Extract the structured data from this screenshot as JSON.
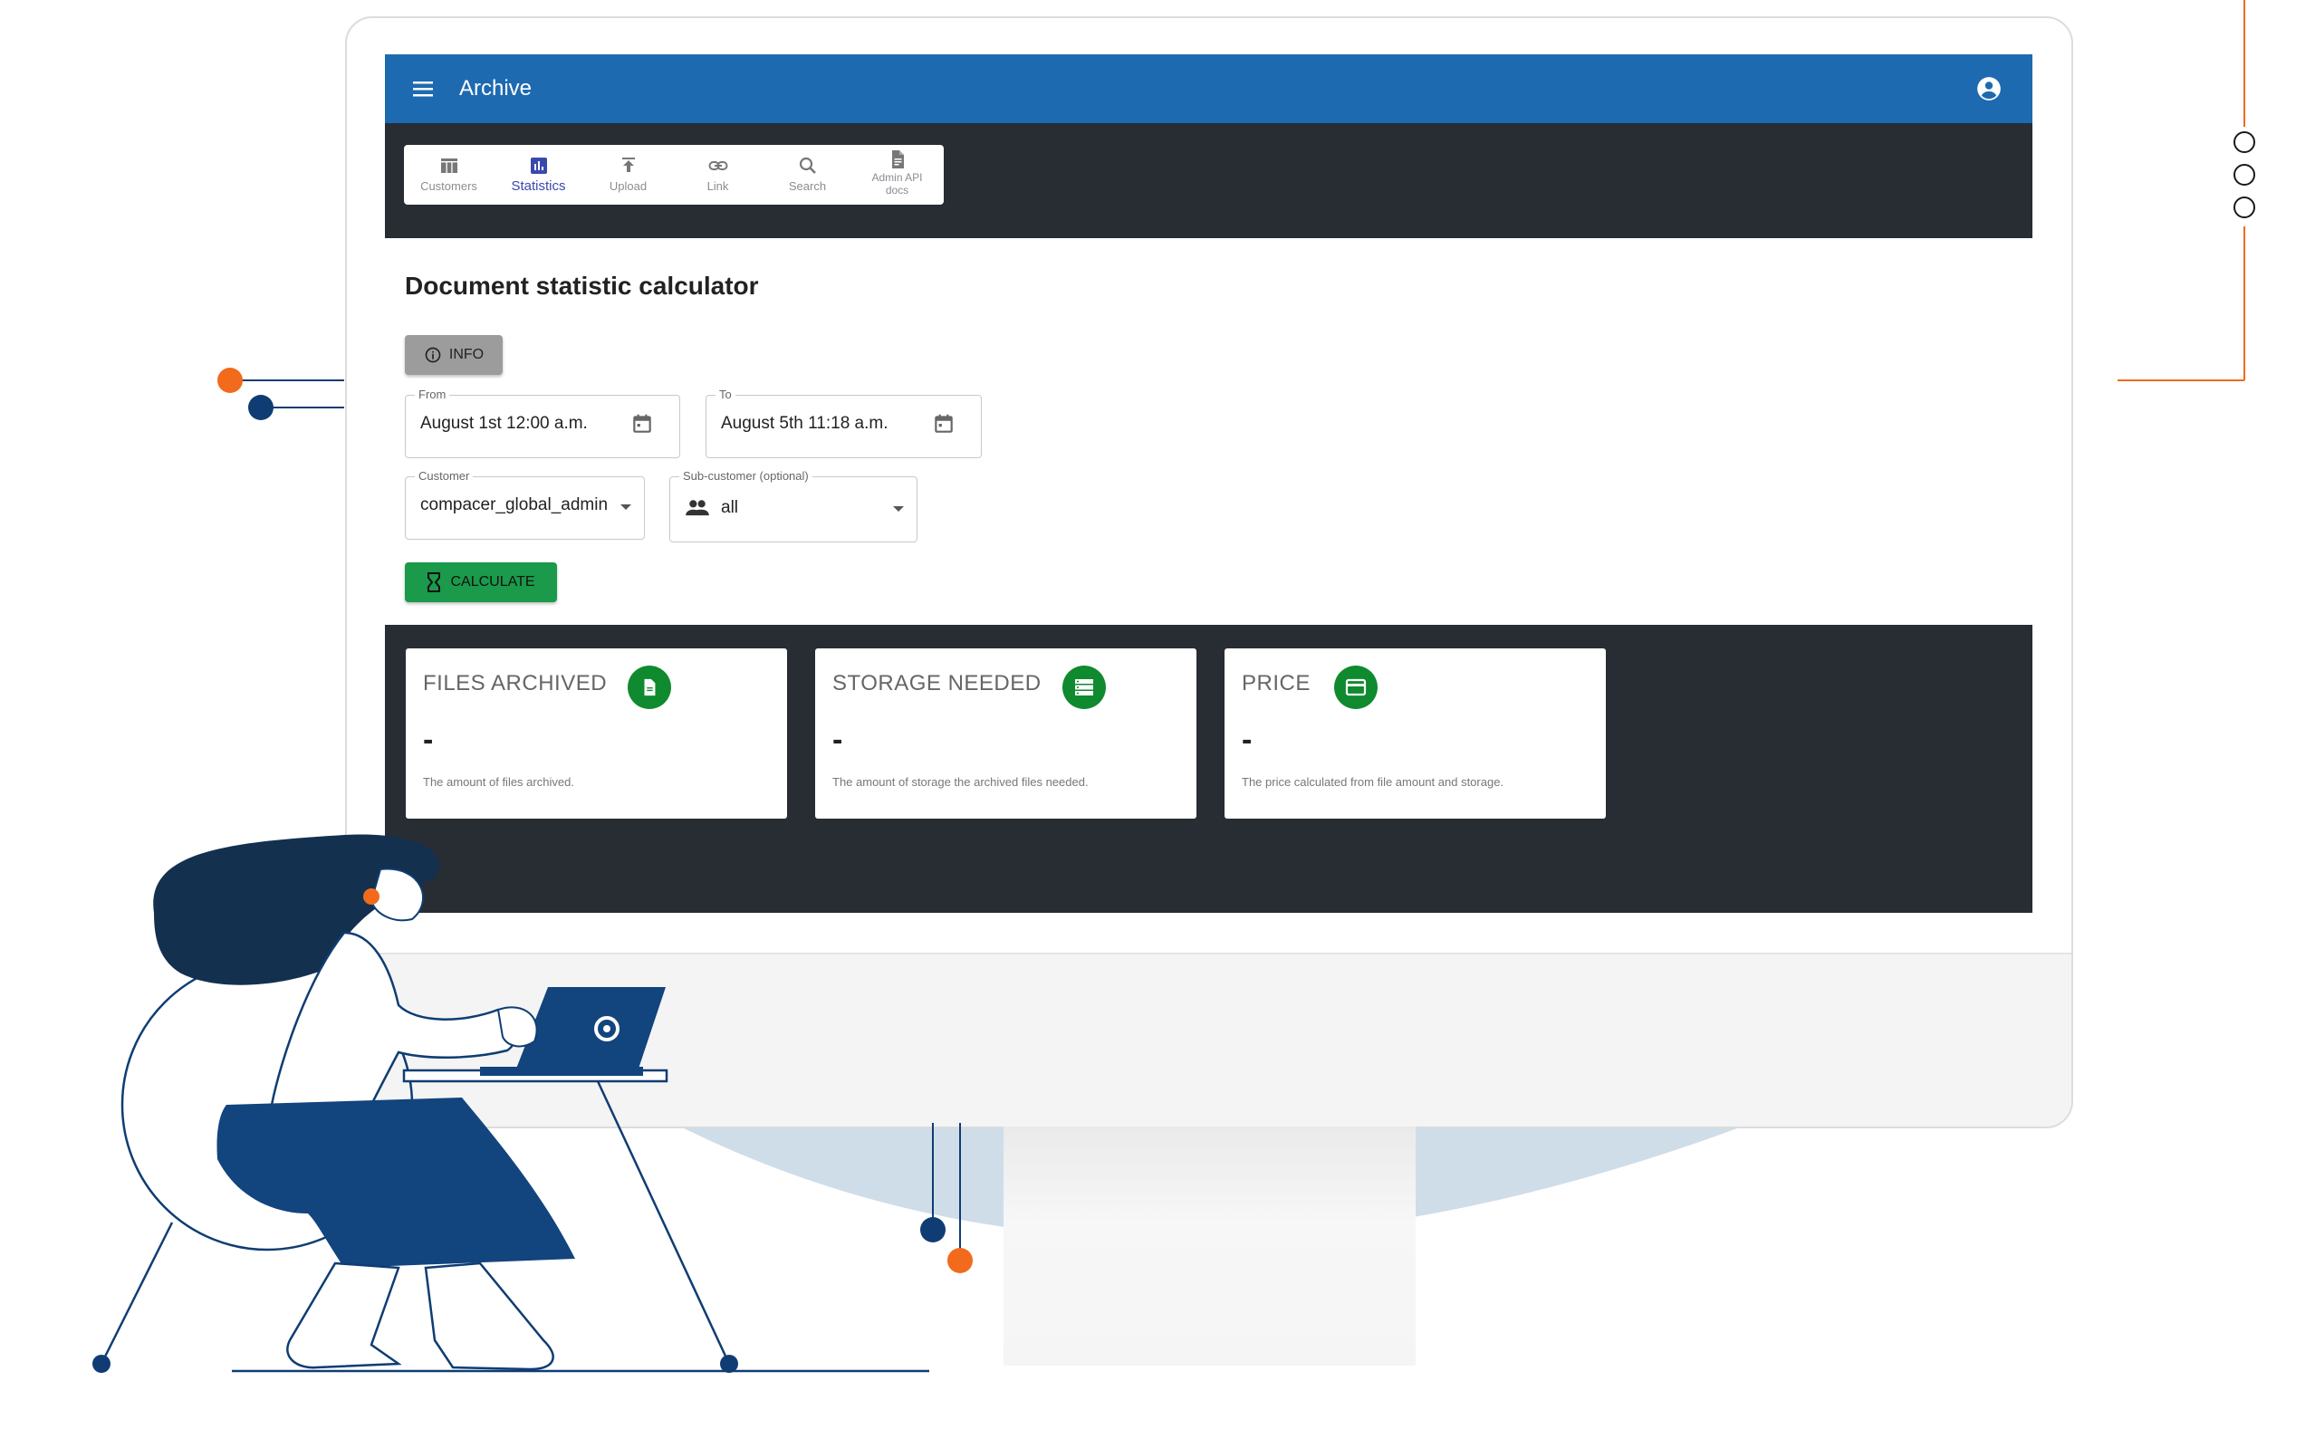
{
  "app": {
    "title": "Archive"
  },
  "tabs": [
    {
      "label": "Customers",
      "icon": "table-icon",
      "active": false
    },
    {
      "label": "Statistics",
      "icon": "bar-chart-icon",
      "active": true
    },
    {
      "label": "Upload",
      "icon": "upload-icon",
      "active": false
    },
    {
      "label": "Link",
      "icon": "link-icon",
      "active": false
    },
    {
      "label": "Search",
      "icon": "search-icon",
      "active": false
    },
    {
      "label": "Admin API docs",
      "icon": "document-icon",
      "active": false
    }
  ],
  "page": {
    "title": "Document statistic calculator",
    "info_label": "INFO",
    "calculate_label": "CALCULATE"
  },
  "form": {
    "from": {
      "label": "From",
      "value": "August 1st 12:00 a.m."
    },
    "to": {
      "label": "To",
      "value": "August 5th 11:18 a.m."
    },
    "customer": {
      "label": "Customer",
      "value": "compacer_global_admin"
    },
    "subcustomer": {
      "label": "Sub-customer (optional)",
      "value": "all"
    }
  },
  "cards": [
    {
      "title": "FILES ARCHIVED",
      "value": "-",
      "description": "The amount of files archived.",
      "icon": "file-icon"
    },
    {
      "title": "STORAGE NEEDED",
      "value": "-",
      "description": "The amount of storage the archived files needed.",
      "icon": "storage-icon"
    },
    {
      "title": "PRICE",
      "value": "-",
      "description": "The price calculated from file amount and storage.",
      "icon": "credit-card-icon"
    }
  ],
  "colors": {
    "appbar": "#1e6ab0",
    "dark_band": "#282c33",
    "active_tab": "#3949ab",
    "calculate_button": "#1a9a4a",
    "card_icon": "#0f8a2e",
    "accent_orange": "#f26a1b",
    "accent_navy": "#0f3d73"
  }
}
